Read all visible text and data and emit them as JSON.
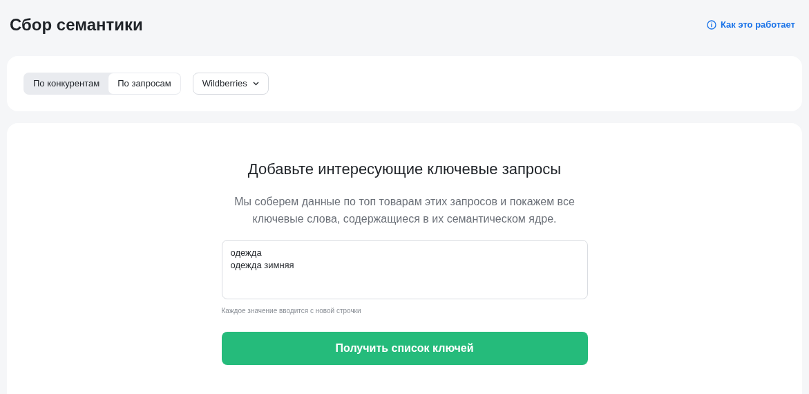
{
  "header": {
    "title": "Сбор семантики",
    "help_link": "Как это работает"
  },
  "tabs": [
    {
      "label": "По конкурентам",
      "selected": false
    },
    {
      "label": "По запросам",
      "selected": true
    }
  ],
  "marketplace_dropdown": {
    "value": "Wildberries"
  },
  "form": {
    "heading": "Добавьте интересующие ключевые запросы",
    "description": "Мы соберем данные по топ товарам этих запросов и покажем все ключевые слова, содержащиеся в их семантическом ядре.",
    "queries": "одежда\nодежда зимняя",
    "hint": "Каждое значение вводится с новой строчки",
    "submit": "Получить список ключей"
  }
}
